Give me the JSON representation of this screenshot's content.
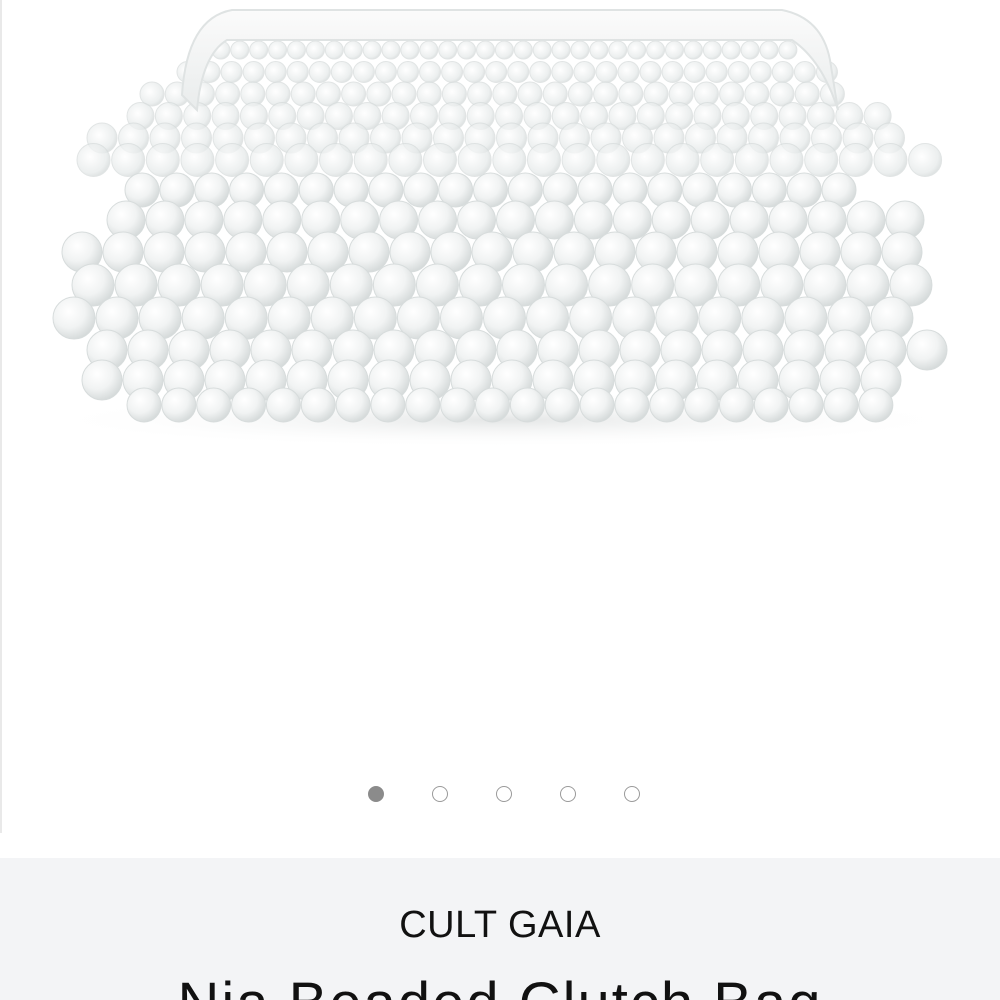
{
  "product": {
    "image_alt": "Nia Beaded Clutch Bag",
    "brand": "CULT GAIA",
    "title": "Nia Beaded Clutch Bag"
  },
  "carousel": {
    "total": 5,
    "active_index": 0
  },
  "colors": {
    "panel_bg": "#f3f4f6",
    "dot_active": "#8b8b8b",
    "dot_border": "#9a9a9a",
    "text": "#111111"
  }
}
